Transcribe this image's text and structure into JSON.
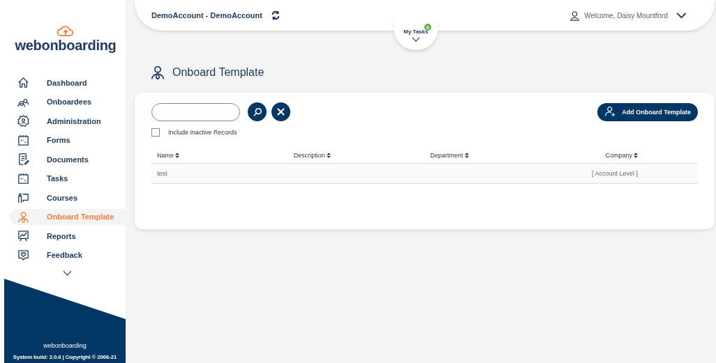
{
  "sidebar": {
    "logo": "webonboarding",
    "items": [
      {
        "label": "Dashboard",
        "selected": false
      },
      {
        "label": "Onboardees",
        "selected": false
      },
      {
        "label": "Administration",
        "selected": false
      },
      {
        "label": "Forms",
        "selected": false
      },
      {
        "label": "Documents",
        "selected": false
      },
      {
        "label": "Tasks",
        "selected": false
      },
      {
        "label": "Courses",
        "selected": false
      },
      {
        "label": "Onboard Template",
        "selected": true
      },
      {
        "label": "Reports",
        "selected": false
      },
      {
        "label": "Feedback",
        "selected": false
      }
    ],
    "footer_logo": "webonboarding",
    "footer_text": "System build: 2.0.6 | Copyright © 2006-21"
  },
  "header": {
    "account": "DemoAccount - DemoAccount",
    "welcome": "Welcome, Daisy Mountford",
    "my_tasks": "My Tasks",
    "task_count": "0"
  },
  "page_title": "Onboard Template",
  "toolbar": {
    "add_button": "Add Onboard Template",
    "include_inactive": {
      "label": "Include Inactive Records",
      "checked": false
    }
  },
  "table": {
    "columns": [
      "Name",
      "Description",
      "Department",
      "Company"
    ],
    "rows": [
      [
        "test",
        "",
        "",
        "[ Account Level ]"
      ]
    ]
  }
}
